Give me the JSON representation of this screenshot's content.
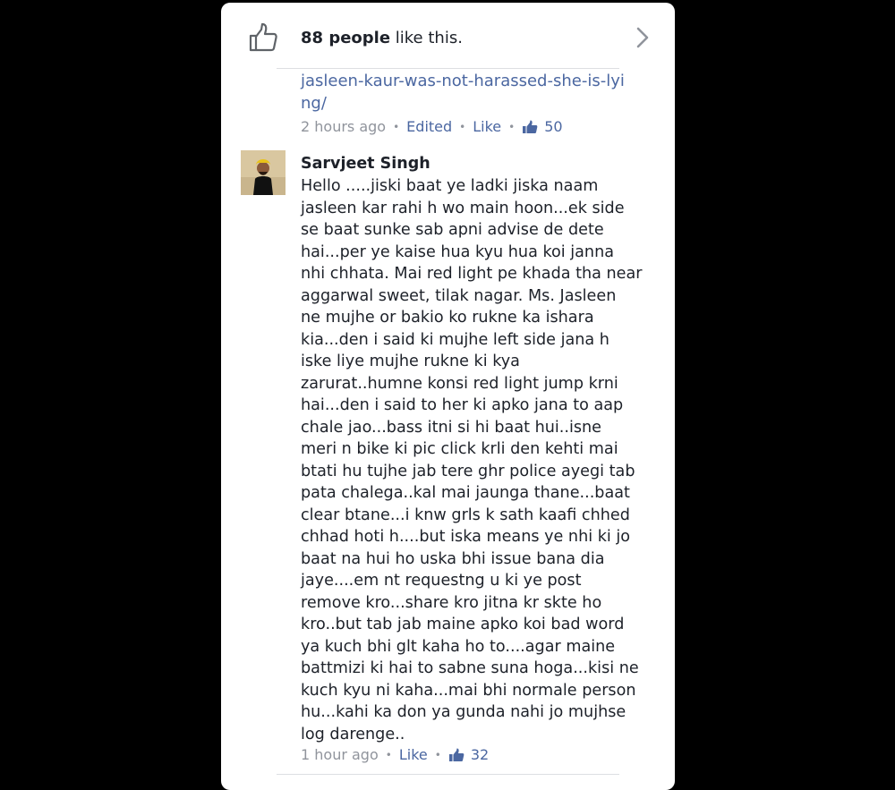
{
  "summary": {
    "likes_count": "88 people",
    "likes_suffix": " like this."
  },
  "first_comment": {
    "link_text": "jasleen-kaur-was-not-harassed-she-is-lying/",
    "time": "2 hours ago",
    "edited": "Edited",
    "like_label": "Like",
    "like_count": "50"
  },
  "second_comment": {
    "author": "Sarvjeet Singh",
    "text": "Hello .....jiski baat ye ladki jiska naam\njasleen kar rahi h wo main hoon...ek side\nse baat sunke sab apni advise de dete\nhai...per ye kaise hua kyu hua koi janna\nnhi chhata. Mai red light pe khada tha near\naggarwal sweet, tilak nagar. Ms. Jasleen\nne mujhe or bakio ko rukne ka ishara\nkia...den i said ki mujhe left side jana h\niske liye mujhe rukne ki kya\nzarurat..humne konsi red light jump krni\nhai...den i said to her ki apko jana to aap\nchale jao...bass itni si hi baat hui..isne\nmeri n bike ki pic click krli den kehti mai\nbtati hu tujhe jab tere ghr police ayegi tab\npata chalega..kal mai jaunga thane...baat\nclear btane...i knw grls k sath kaafi chhed\nchhad hoti h....but iska means ye nhi ki jo\nbaat na hui ho uska bhi issue bana dia\njaye....em nt requestng u ki ye post\nremove kro...share kro jitna kr skte ho\nkro..but tab jab maine apko koi bad word\nya kuch bhi glt kaha ho to....agar maine\nbattmizi ki hai to sabne suna hoga...kisi ne\nkuch kyu ni kaha...mai bhi normale person\nhu...kahi ka don ya gunda nahi jo mujhse\nlog darenge..",
    "time": "1 hour ago",
    "like_label": "Like",
    "like_count": "32"
  },
  "colors": {
    "background": "#000000",
    "card": "#ffffff",
    "link": "#4b67a1",
    "muted": "#90949c",
    "text": "#1d2129"
  }
}
